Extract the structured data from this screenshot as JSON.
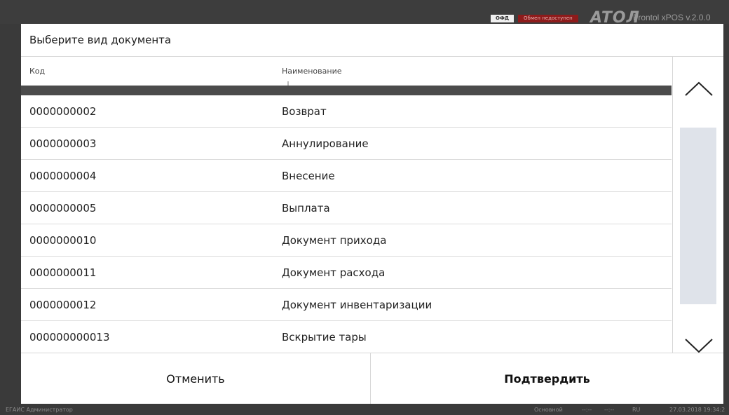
{
  "topbar": {
    "ofd_label": "ОФД",
    "exchange_label": "Обмен недоступен",
    "logo_text": "ATOЛ",
    "app_name": "Frontol xPOS v.2.0.0"
  },
  "dialog": {
    "title": "Выберите вид документа",
    "columns": {
      "code": "Код",
      "name": "Наименование"
    },
    "rows": [
      {
        "code": "0000000002",
        "name": "Возврат"
      },
      {
        "code": "0000000003",
        "name": "Аннулирование"
      },
      {
        "code": "0000000004",
        "name": "Внесение"
      },
      {
        "code": "0000000005",
        "name": "Выплата"
      },
      {
        "code": "0000000010",
        "name": "Документ прихода"
      },
      {
        "code": "0000000011",
        "name": "Документ расхода"
      },
      {
        "code": "0000000012",
        "name": "Документ инвентаризации"
      },
      {
        "code": "000000000013",
        "name": "Вскрытие тары"
      }
    ],
    "cancel_label": "Отменить",
    "confirm_label": "Подтвердить"
  },
  "status": {
    "left": "ЕГАИС  Администратор",
    "mode": "Основной",
    "time1": "--:--",
    "time2": "--:--",
    "lang": "RU",
    "datetime": "27.03.2018 19:34:2"
  },
  "icons": {
    "up": "chevron-up-icon",
    "down": "chevron-down-icon"
  }
}
